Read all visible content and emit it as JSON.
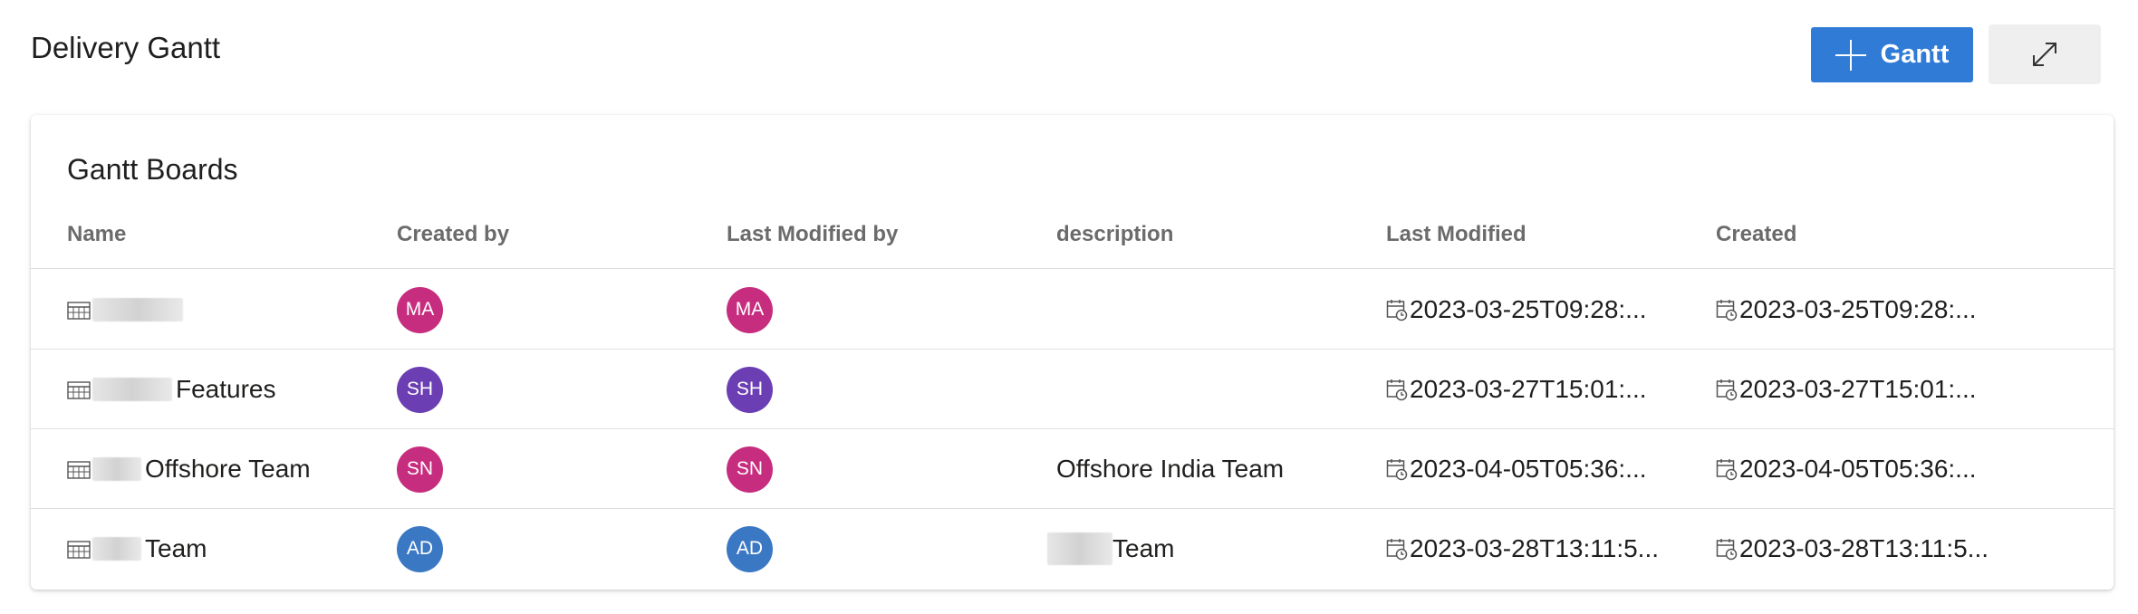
{
  "page": {
    "title": "Delivery Gantt"
  },
  "toolbar": {
    "add_label": "Gantt",
    "add_icon": "plus-icon",
    "expand_icon": "expand-icon"
  },
  "card": {
    "title": "Gantt Boards"
  },
  "columns": [
    "Name",
    "Created by",
    "Last Modified by",
    "description",
    "Last Modified",
    "Created"
  ],
  "rows": [
    {
      "name": "",
      "created_by": "MA",
      "created_by_color": "#c72d7e",
      "modified_by": "MA",
      "modified_by_color": "#c72d7e",
      "description": "",
      "last_modified": "2023-03-25T09:28:...",
      "created": "2023-03-25T09:28:..."
    },
    {
      "name": "Features",
      "created_by": "SH",
      "created_by_color": "#6b3fb3",
      "modified_by": "SH",
      "modified_by_color": "#6b3fb3",
      "description": "",
      "last_modified": "2023-03-27T15:01:...",
      "created": "2023-03-27T15:01:..."
    },
    {
      "name": "Offshore Team",
      "created_by": "SN",
      "created_by_color": "#c72d7e",
      "modified_by": "SN",
      "modified_by_color": "#c72d7e",
      "description": "Offshore India Team",
      "last_modified": "2023-04-05T05:36:...",
      "created": "2023-04-05T05:36:..."
    },
    {
      "name": "Team",
      "created_by": "AD",
      "created_by_color": "#3b78c4",
      "modified_by": "AD",
      "modified_by_color": "#3b78c4",
      "description": "Team",
      "last_modified": "2023-03-28T13:11:5...",
      "created": "2023-03-28T13:11:5..."
    }
  ]
}
